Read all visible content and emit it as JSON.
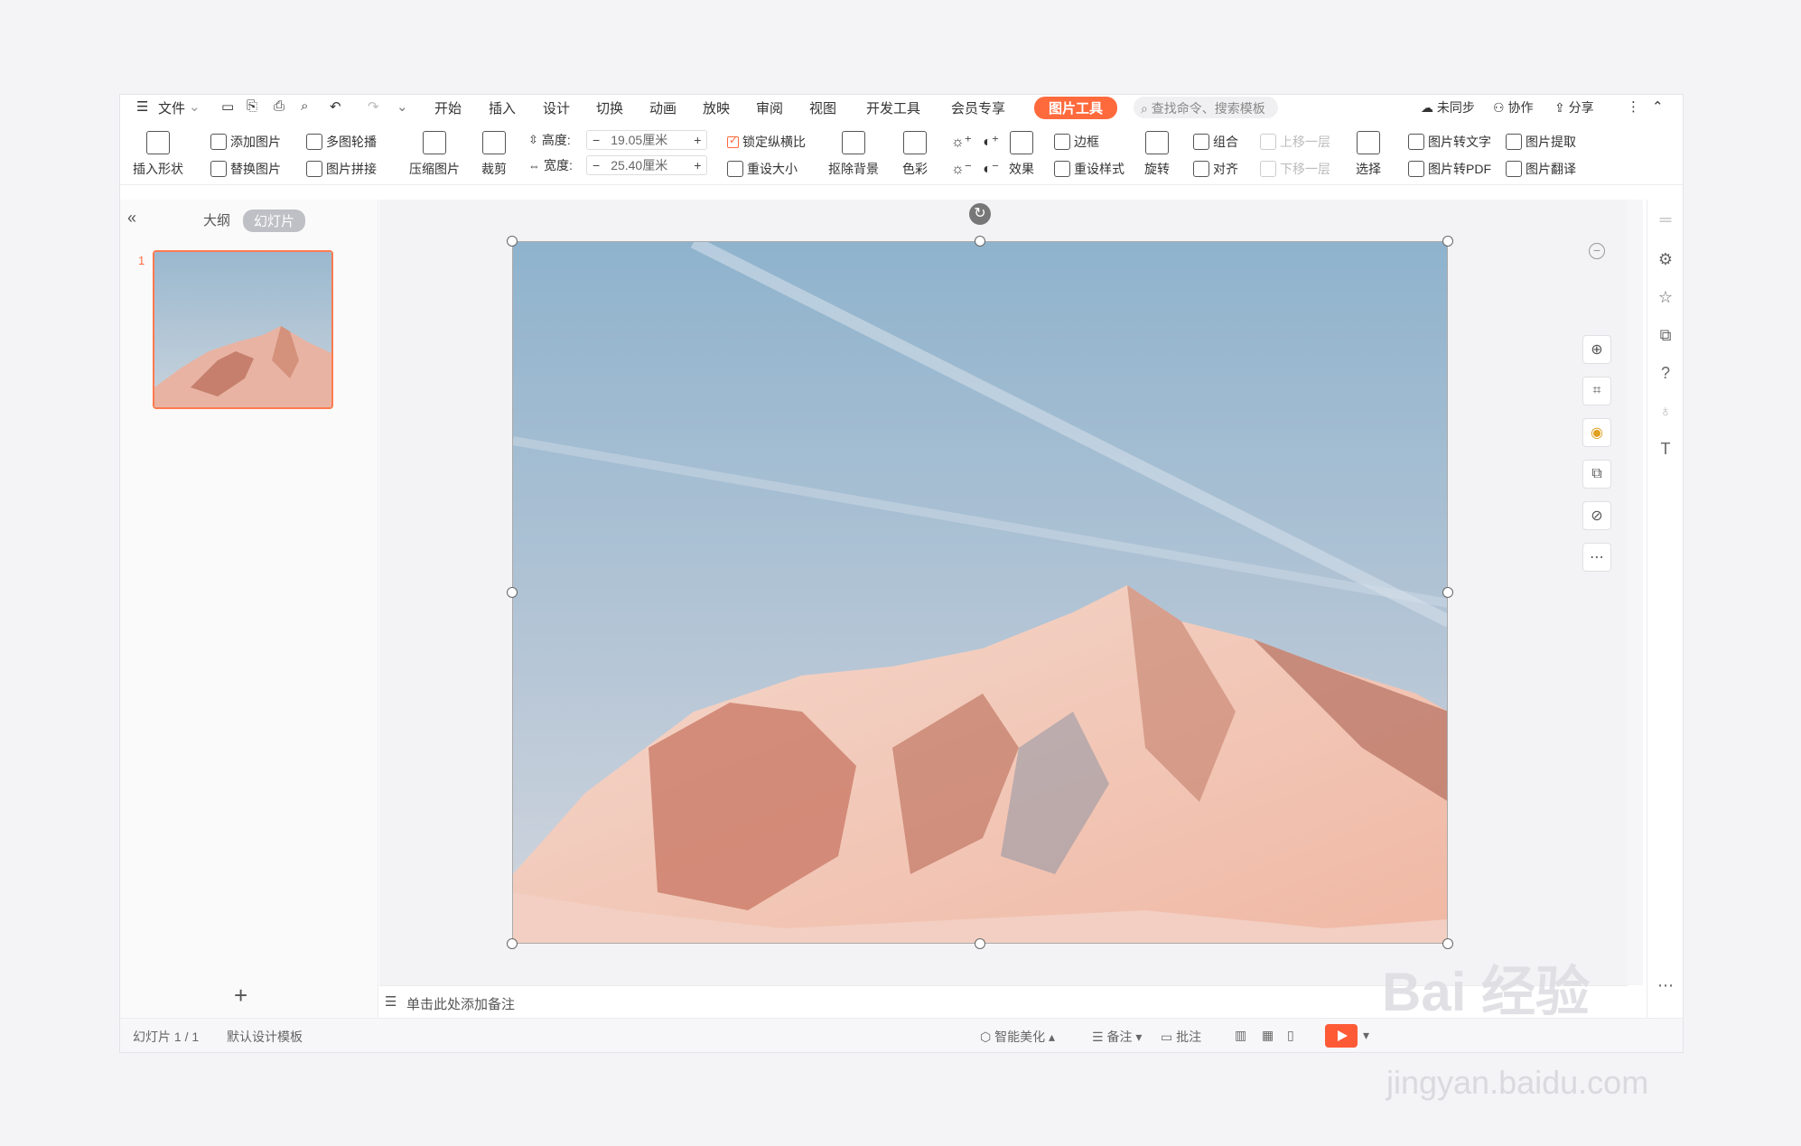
{
  "menubar": {
    "file": "文件",
    "tabs": [
      "开始",
      "插入",
      "设计",
      "切换",
      "动画",
      "放映",
      "审阅",
      "视图",
      "开发工具",
      "会员专享"
    ],
    "active_tab": "图片工具",
    "search_placeholder": "查找命令、搜索模板",
    "sync": "未同步",
    "collab": "协作",
    "share": "分享"
  },
  "ribbon": {
    "insert_shape": "插入形状",
    "add_picture": "添加图片",
    "replace_picture": "替换图片",
    "multi_carousel": "多图轮播",
    "picture_splice": "图片拼接",
    "compress": "压缩图片",
    "crop": "裁剪",
    "height_label": "高度:",
    "height_value": "19.05厘米",
    "width_label": "宽度:",
    "width_value": "25.40厘米",
    "lock_ratio": "锁定纵横比",
    "reset_size": "重设大小",
    "remove_bg": "抠除背景",
    "color": "色彩",
    "effects": "效果",
    "border": "边框",
    "reset_style": "重设样式",
    "rotate": "旋转",
    "group": "组合",
    "align": "对齐",
    "bring_forward": "上移一层",
    "send_backward": "下移一层",
    "select": "选择",
    "pic_to_text": "图片转文字",
    "pic_extract": "图片提取",
    "pic_to_pdf": "图片转PDF",
    "pic_translate": "图片翻译",
    "minus": "−",
    "plus": "+"
  },
  "sidebar": {
    "tab_outline": "大纲",
    "tab_slides": "幻灯片",
    "slide_number": "1",
    "add": "+"
  },
  "notes": {
    "placeholder": "单击此处添加备注"
  },
  "statusbar": {
    "slide_counter": "幻灯片 1 / 1",
    "template": "默认设计模板",
    "beautify": "智能美化",
    "notes": "备注",
    "comments": "批注"
  },
  "watermark": {
    "brand": "Bai 经验",
    "url": "jingyan.baidu.com"
  },
  "colors": {
    "accent": "#ff6a3d",
    "play": "#ff5a36"
  }
}
